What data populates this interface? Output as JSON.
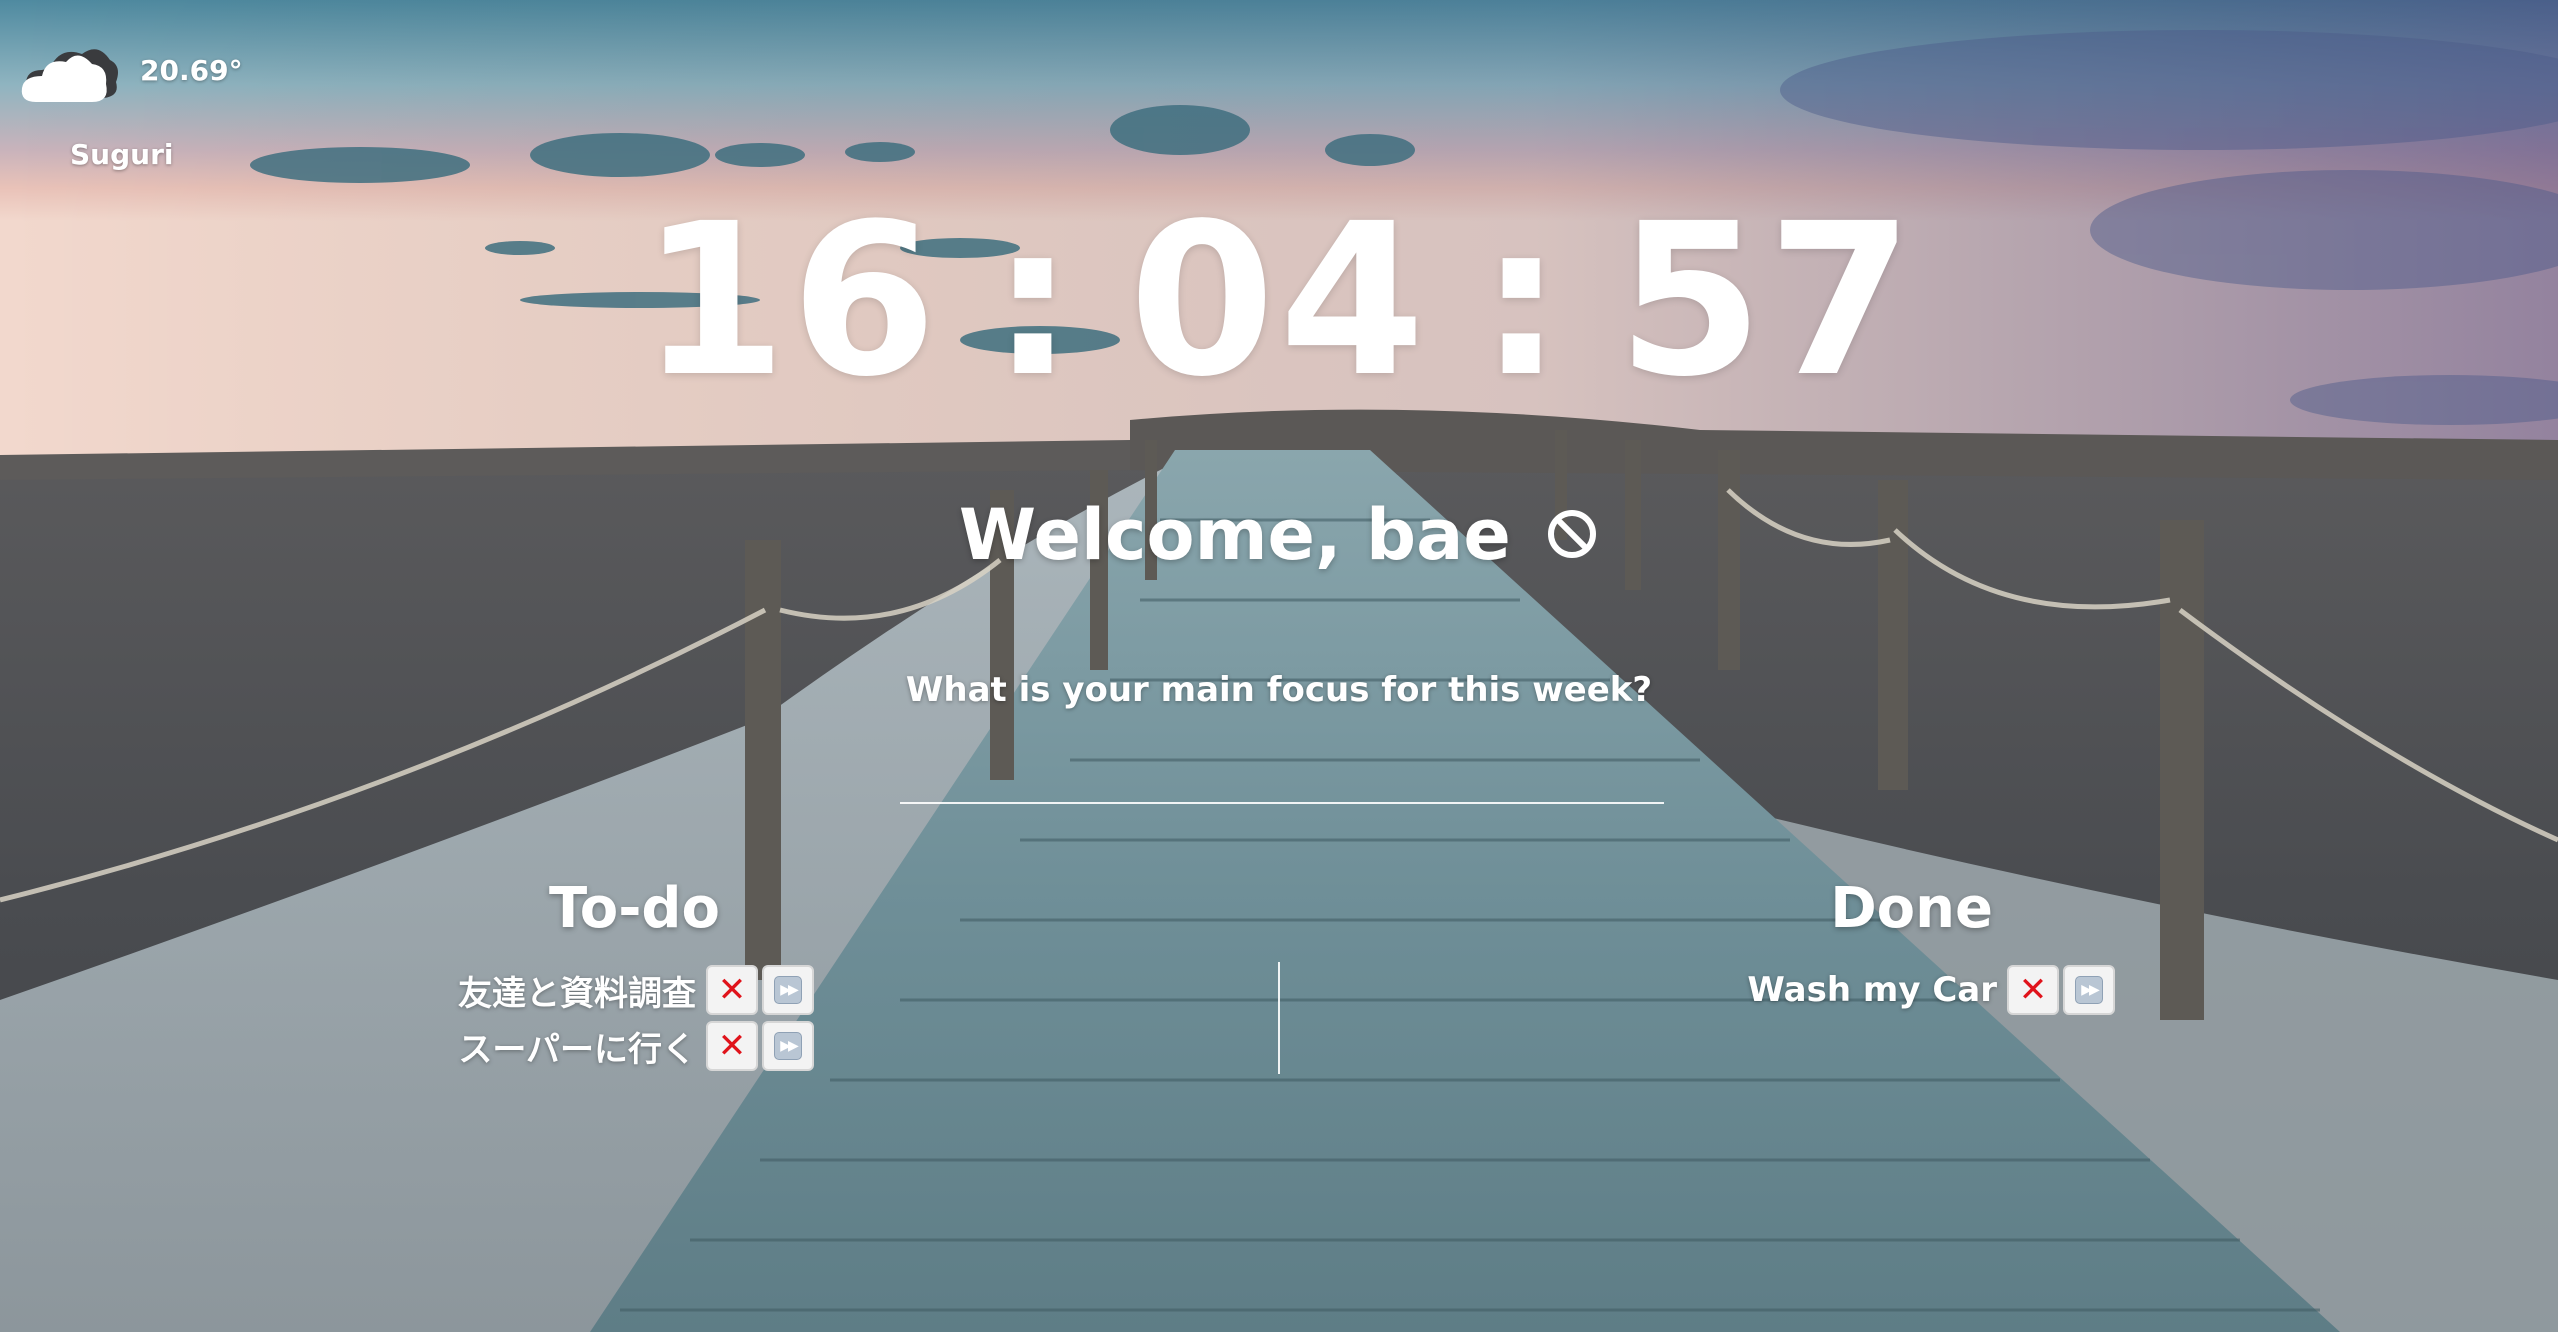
{
  "weather": {
    "temperature": "20.69°",
    "city": "Suguri",
    "icon": "cloud-icon"
  },
  "clock": {
    "hours": "16",
    "minutes": "04",
    "seconds": "57",
    "separator": ":"
  },
  "welcome": {
    "text": "Welcome, bae",
    "icon": "block-icon"
  },
  "focus": {
    "prompt": "What is your main focus for this week?",
    "value": "",
    "placeholder": ""
  },
  "todo": {
    "title": "To-do",
    "items": [
      {
        "label": "友達と資料調査"
      },
      {
        "label": "スーパーに行く"
      }
    ]
  },
  "done": {
    "title": "Done",
    "items": [
      {
        "label": "Wash my Car"
      }
    ]
  },
  "buttons": {
    "delete_glyph": "✕",
    "forward_glyph": "▶▶"
  }
}
